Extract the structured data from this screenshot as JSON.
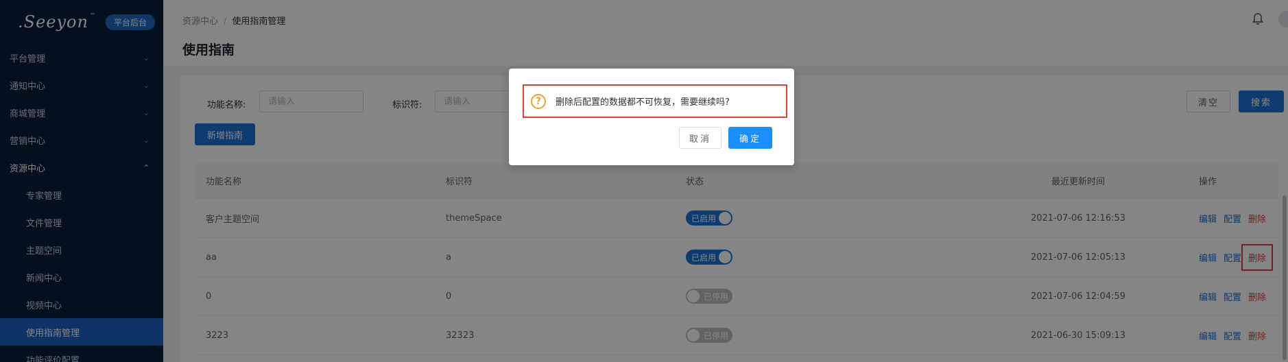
{
  "brand": {
    "logo": ".Seeyon",
    "tm": "™",
    "badge": "平台后台"
  },
  "sidebar": {
    "menus": [
      {
        "label": "平台管理",
        "icon": "chevron-down-icon"
      },
      {
        "label": "通知中心",
        "icon": "chevron-down-icon"
      },
      {
        "label": "商城管理",
        "icon": "chevron-down-icon"
      },
      {
        "label": "营销中心",
        "icon": "chevron-down-icon"
      },
      {
        "label": "资源中心",
        "icon": "chevron-up-icon"
      }
    ],
    "sub_items": [
      {
        "label": "专家管理"
      },
      {
        "label": "文件管理"
      },
      {
        "label": "主题空间"
      },
      {
        "label": "新闻中心"
      },
      {
        "label": "视频中心"
      },
      {
        "label": "使用指南管理",
        "active": true
      },
      {
        "label": "功能评价配置"
      }
    ]
  },
  "header": {
    "breadcrumb": [
      "资源中心",
      "使用指南管理"
    ],
    "breadcrumb_sep": "/",
    "title": "使用指南"
  },
  "filters": {
    "name_label": "功能名称:",
    "name_placeholder": "请输入",
    "code_label": "标识符:",
    "code_placeholder": "请输入",
    "clear_label": "清空",
    "search_label": "搜索",
    "add_label": "新增指南"
  },
  "table": {
    "columns": [
      "功能名称",
      "标识符",
      "状态",
      "最近更新时间",
      "操作"
    ],
    "rows": [
      {
        "name": "客户主题空间",
        "code": "themeSpace",
        "status": "已启用",
        "enabled": true,
        "updated": "2021-07-06 12:16:53"
      },
      {
        "name": "aa",
        "code": "a",
        "status": "已启用",
        "enabled": true,
        "updated": "2021-07-06 12:05:13"
      },
      {
        "name": "0",
        "code": "0",
        "status": "已停用",
        "enabled": false,
        "updated": "2021-07-06 12:04:59"
      },
      {
        "name": "3223",
        "code": "32323",
        "status": "已停用",
        "enabled": false,
        "updated": "2021-06-30 15:09:13"
      }
    ],
    "actions": {
      "edit": "编辑",
      "config": "配置",
      "delete": "删除"
    }
  },
  "dialog": {
    "message": "删除后配置的数据都不可恢复，需要继续吗?",
    "cancel_label": "取消",
    "ok_label": "确定",
    "icon": "question-circle-icon"
  },
  "colors": {
    "sidebar_bg": "#0b1f3a",
    "primary": "#1a73d8",
    "danger": "#e0413a",
    "warning": "#f0a020"
  }
}
